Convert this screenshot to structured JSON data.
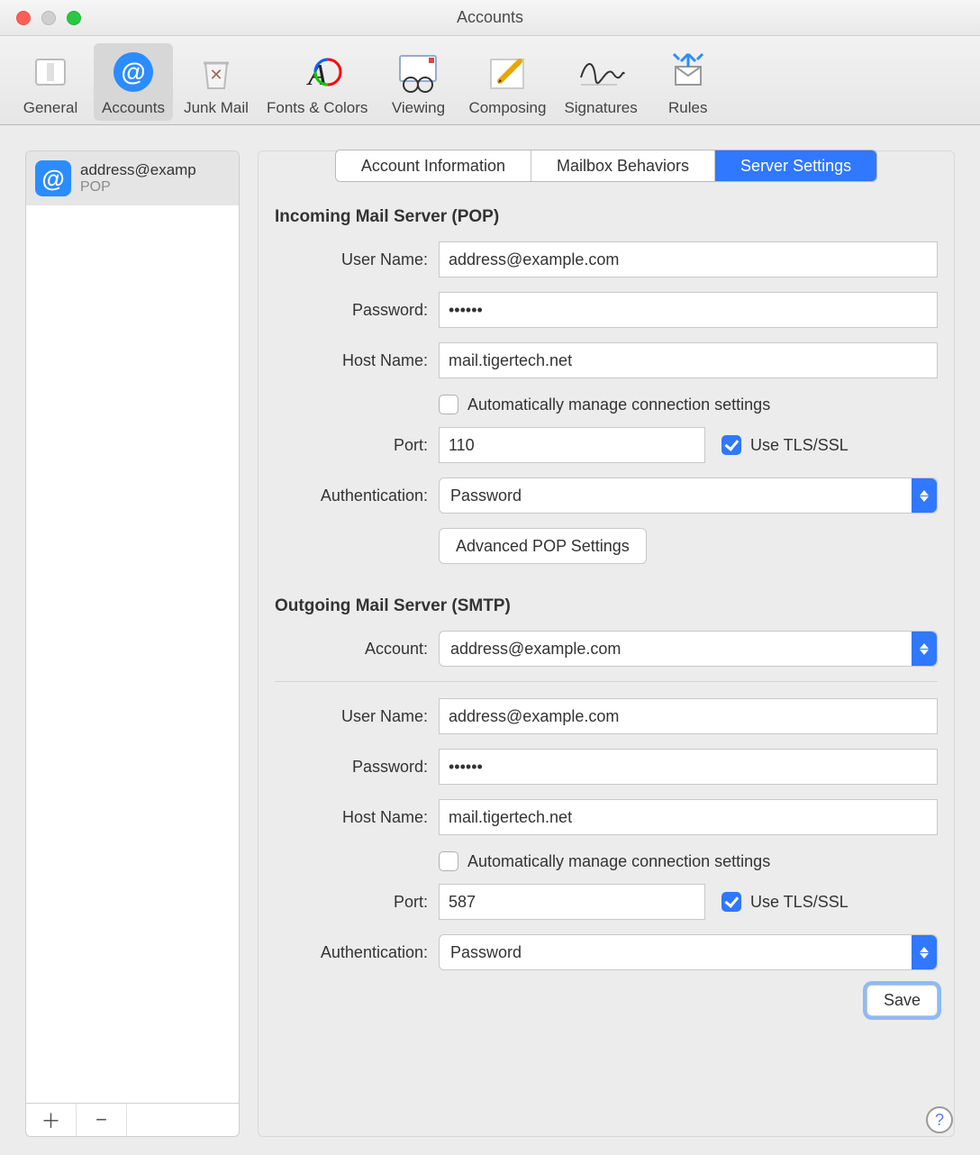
{
  "window_title": "Accounts",
  "toolbar": [
    {
      "id": "general",
      "label": "General"
    },
    {
      "id": "accounts",
      "label": "Accounts"
    },
    {
      "id": "junk",
      "label": "Junk Mail"
    },
    {
      "id": "fonts",
      "label": "Fonts & Colors"
    },
    {
      "id": "viewing",
      "label": "Viewing"
    },
    {
      "id": "composing",
      "label": "Composing"
    },
    {
      "id": "signatures",
      "label": "Signatures"
    },
    {
      "id": "rules",
      "label": "Rules"
    }
  ],
  "sidebar": {
    "account_name": "address@examp",
    "account_type": "POP",
    "add_symbol": "＋",
    "remove_symbol": "−"
  },
  "tabs": {
    "info": "Account Information",
    "mailbox": "Mailbox Behaviors",
    "server": "Server Settings"
  },
  "incoming": {
    "heading": "Incoming Mail Server (POP)",
    "username_label": "User Name:",
    "username_value": "address@example.com",
    "password_label": "Password:",
    "password_value": "••••••",
    "host_label": "Host Name:",
    "host_value": "mail.tigertech.net",
    "auto_label": "Automatically manage connection settings",
    "auto_checked": false,
    "port_label": "Port:",
    "port_value": "110",
    "tls_label": "Use TLS/SSL",
    "tls_checked": true,
    "auth_label": "Authentication:",
    "auth_value": "Password",
    "adv_button": "Advanced POP Settings"
  },
  "outgoing": {
    "heading": "Outgoing Mail Server (SMTP)",
    "account_label": "Account:",
    "account_value": "address@example.com",
    "username_label": "User Name:",
    "username_value": "address@example.com",
    "password_label": "Password:",
    "password_value": "••••••",
    "host_label": "Host Name:",
    "host_value": "mail.tigertech.net",
    "auto_label": "Automatically manage connection settings",
    "auto_checked": false,
    "port_label": "Port:",
    "port_value": "587",
    "tls_label": "Use TLS/SSL",
    "tls_checked": true,
    "auth_label": "Authentication:",
    "auth_value": "Password"
  },
  "save_label": "Save",
  "help_symbol": "?"
}
